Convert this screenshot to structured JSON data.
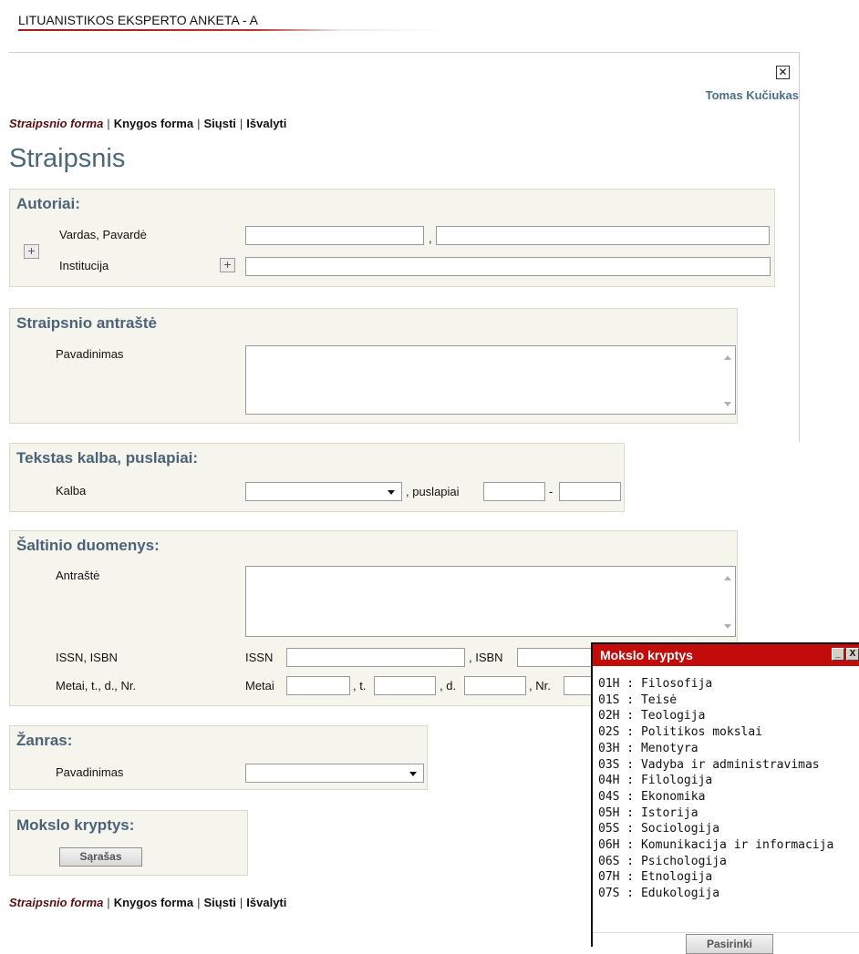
{
  "header": {
    "title": "LITUANISTIKOS EKSPERTO ANKETA - A"
  },
  "user": {
    "name": "Tomas Kučiukas"
  },
  "close_glyph": "✕",
  "nav": {
    "article_form": "Straipsnio forma",
    "book_form": "Knygos forma",
    "send": "Siųsti",
    "clear": "Išvalyti",
    "separator": "|"
  },
  "page": {
    "title": "Straipsnis"
  },
  "authors": {
    "title": "Autoriai:",
    "name_label": "Vardas, Pavardė",
    "comma": ",",
    "institution_label": "Institucija",
    "plus": "+"
  },
  "article_title": {
    "title": "Straipsnio antraštė",
    "name_label": "Pavadinimas"
  },
  "language": {
    "title": "Tekstas kalba, puslapiai:",
    "language_label": "Kalba",
    "pages_label": ", puslapiai",
    "dash": "-"
  },
  "source": {
    "title": "Šaltinio duomenys:",
    "title_label": "Antraštė",
    "issn_isbn_label": "ISSN, ISBN",
    "issn_prefix": "ISSN",
    "isbn_prefix": ", ISBN",
    "year_line_label": "Metai, t., d., Nr.",
    "year_prefix": "Metai",
    "volume_prefix": ", t.",
    "part_prefix": ", d.",
    "number_prefix": ", Nr."
  },
  "genre": {
    "title": "Žanras:",
    "name_label": "Pavadinimas"
  },
  "field": {
    "title": "Mokslo kryptys:",
    "list_button": "Sąrašas"
  },
  "popup": {
    "title": "Mokslo kryptys",
    "minimize_glyph": "_",
    "close_glyph": "X",
    "items": [
      "01H : Filosofija",
      "01S : Teisė",
      "02H : Teologija",
      "02S : Politikos mokslai",
      "03H : Menotyra",
      "03S : Vadyba ir administravimas",
      "04H : Filologija",
      "04S : Ekonomika",
      "05H : Istorija",
      "05S : Sociologija",
      "06H : Komunikacija ir informacija",
      "06S : Psichologija",
      "07H : Etnologija",
      "07S : Edukologija"
    ],
    "select_button": "Pasirinki"
  }
}
